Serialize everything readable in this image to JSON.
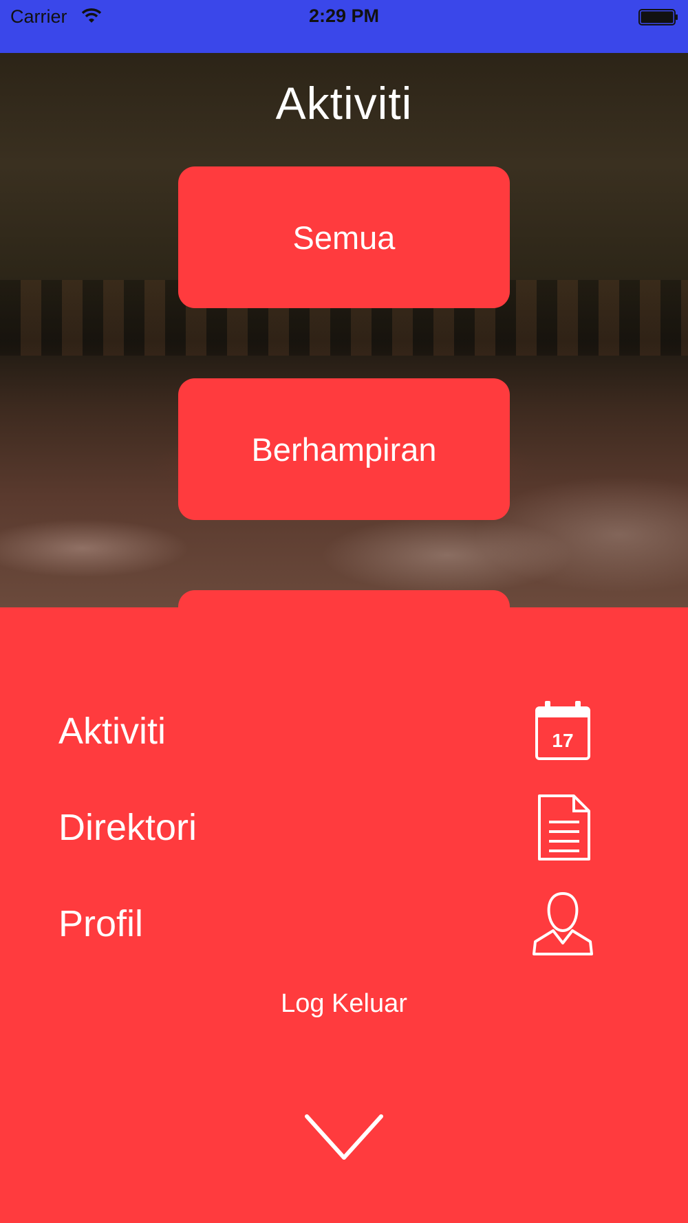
{
  "status_bar": {
    "carrier": "Carrier",
    "time": "2:29 PM",
    "wifi_icon": "wifi-icon",
    "battery_icon": "battery-icon"
  },
  "header": {
    "title": "Aktiviti"
  },
  "categories": {
    "all_label": "Semua",
    "nearby_label": "Berhampiran"
  },
  "menu": {
    "items": [
      {
        "label": "Aktiviti",
        "icon": "calendar-icon",
        "icon_text": "17"
      },
      {
        "label": "Direktori",
        "icon": "document-icon"
      },
      {
        "label": "Profil",
        "icon": "user-icon"
      }
    ],
    "logout_label": "Log Keluar",
    "collapse_icon": "chevron-down-icon"
  },
  "colors": {
    "status_bar": "#3a47ea",
    "accent_red": "#ff3b3e",
    "text": "#ffffff"
  }
}
